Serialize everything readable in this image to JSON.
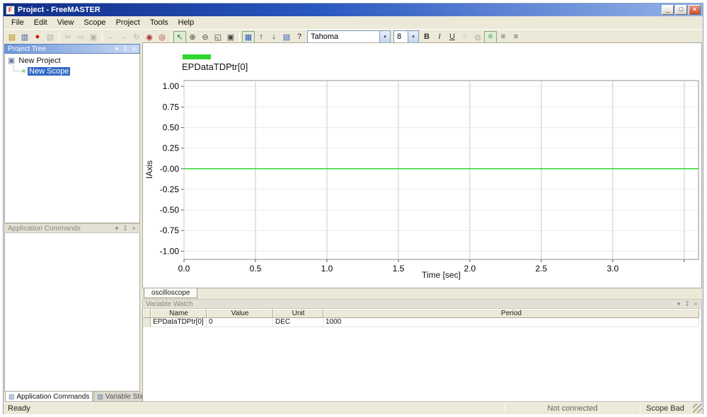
{
  "window": {
    "title": "Project - FreeMASTER",
    "app_icon_glyph": "F",
    "minimize_glyph": "_",
    "maximize_glyph": "□",
    "close_glyph": "×"
  },
  "menu": {
    "items": [
      "File",
      "Edit",
      "View",
      "Scope",
      "Project",
      "Tools",
      "Help"
    ]
  },
  "toolbar": {
    "font_combo": {
      "value": "Tahoma"
    },
    "size_combo": {
      "value": "8"
    },
    "items": [
      {
        "type": "icon",
        "name": "open-project-icon",
        "glyph": "▤",
        "color": "#b8860b",
        "state": "normal"
      },
      {
        "type": "icon",
        "name": "save-project-icon",
        "glyph": "▥",
        "color": "#33589e",
        "state": "normal"
      },
      {
        "type": "icon",
        "name": "stop-communication-icon",
        "glyph": "●",
        "color": "#cc1100",
        "state": "normal"
      },
      {
        "type": "icon",
        "name": "options-icon",
        "glyph": "▧",
        "color": "#8a8a8a",
        "state": "disabled"
      },
      {
        "type": "sep"
      },
      {
        "type": "icon",
        "name": "cut-icon",
        "glyph": "✂",
        "color": "#8a8a8a",
        "state": "disabled"
      },
      {
        "type": "icon",
        "name": "copy-icon",
        "glyph": "▭",
        "color": "#8a8a8a",
        "state": "disabled"
      },
      {
        "type": "icon",
        "name": "paste-icon",
        "glyph": "▣",
        "color": "#8a8a8a",
        "state": "disabled"
      },
      {
        "type": "sep"
      },
      {
        "type": "icon",
        "name": "back-icon",
        "glyph": "←",
        "color": "#8a8a8a",
        "state": "disabled"
      },
      {
        "type": "icon",
        "name": "forward-icon",
        "glyph": "→",
        "color": "#8a8a8a",
        "state": "disabled"
      },
      {
        "type": "icon",
        "name": "refresh-icon",
        "glyph": "↻",
        "color": "#8a8a8a",
        "state": "disabled"
      },
      {
        "type": "icon",
        "name": "record-icon",
        "glyph": "◉",
        "color": "#aa3333",
        "state": "normal"
      },
      {
        "type": "icon",
        "name": "pin-variables-icon",
        "glyph": "◎",
        "color": "#aa3333",
        "state": "normal"
      },
      {
        "type": "sep"
      },
      {
        "type": "icon",
        "name": "cursor-tool-icon",
        "glyph": "↖",
        "color": "#1d7a1d",
        "state": "pressed"
      },
      {
        "type": "icon",
        "name": "zoom-in-icon",
        "glyph": "⊕",
        "color": "#444444",
        "state": "normal"
      },
      {
        "type": "icon",
        "name": "zoom-out-icon",
        "glyph": "⊖",
        "color": "#444444",
        "state": "normal"
      },
      {
        "type": "icon",
        "name": "zoom-fit-icon",
        "glyph": "◱",
        "color": "#444444",
        "state": "normal"
      },
      {
        "type": "icon",
        "name": "copy-image-icon",
        "glyph": "▣",
        "color": "#444444",
        "state": "normal"
      },
      {
        "type": "sep"
      },
      {
        "type": "icon",
        "name": "grid-icon",
        "glyph": "▦",
        "color": "#3355bb",
        "state": "pressed"
      },
      {
        "type": "icon",
        "name": "move-up-icon",
        "glyph": "↑",
        "color": "#222222",
        "state": "normal"
      },
      {
        "type": "icon",
        "name": "move-down-icon",
        "glyph": "↓",
        "color": "#222222",
        "state": "normal"
      },
      {
        "type": "icon",
        "name": "properties-icon",
        "glyph": "▤",
        "color": "#3355bb",
        "state": "normal"
      },
      {
        "type": "icon",
        "name": "context-help-icon",
        "glyph": "?",
        "color": "#222222",
        "state": "normal"
      },
      {
        "type": "font-combo"
      },
      {
        "type": "size-combo"
      },
      {
        "type": "icon",
        "name": "bold-button",
        "glyph": "B",
        "color": "#333333",
        "state": "normal",
        "bold": true
      },
      {
        "type": "icon",
        "name": "italic-button",
        "glyph": "I",
        "color": "#333333",
        "state": "normal",
        "italic": true
      },
      {
        "type": "icon",
        "name": "underline-button",
        "glyph": "U",
        "color": "#333333",
        "state": "normal",
        "underline": true
      },
      {
        "type": "icon",
        "name": "bullet-list-icon",
        "glyph": "○",
        "color": "#8a8a8a",
        "state": "disabled"
      },
      {
        "type": "icon",
        "name": "numbered-list-icon",
        "glyph": "◍",
        "color": "#8a8a8a",
        "state": "disabled"
      },
      {
        "type": "icon",
        "name": "align-left-icon",
        "glyph": "≡",
        "color": "#2f9e2f",
        "state": "pressed"
      },
      {
        "type": "icon",
        "name": "align-center-icon",
        "glyph": "≡",
        "color": "#555555",
        "state": "normal"
      },
      {
        "type": "icon",
        "name": "align-right-icon",
        "glyph": "≡",
        "color": "#555555",
        "state": "normal"
      }
    ]
  },
  "panel_buttons": {
    "chevron": "▾",
    "pin": "↧",
    "close": "×"
  },
  "project_tree": {
    "title": "Project Tree",
    "items": [
      {
        "label": "New Project",
        "icon": "project-icon",
        "glyph": "▣",
        "icon_color": "#6b7f9e",
        "level": 0,
        "selected": false
      },
      {
        "label": "New Scope",
        "icon": "scope-icon",
        "glyph": "≈",
        "icon_color": "#18a018",
        "level": 1,
        "selected": true
      }
    ]
  },
  "application_commands": {
    "title": "Application Commands"
  },
  "dock_tabs": [
    {
      "label": "Application Commands",
      "icon_glyph": "▧",
      "active": true
    },
    {
      "label": "Variable Stimulus",
      "icon_glyph": "▧",
      "active": false
    }
  ],
  "scope": {
    "tab_label": "oscilloscope",
    "chart_data": {
      "type": "line",
      "title": "EPDataTDPtr[0]",
      "xlabel": "Time [sec]",
      "ylabel": "IAxis",
      "xlim": [
        0,
        3.6
      ],
      "ylim": [
        -1.1,
        1.07
      ],
      "x_ticks": [
        0,
        0.5,
        1,
        1.5,
        2,
        2.5,
        3,
        3.5
      ],
      "x_tick_labels": [
        "0.0",
        "0.5",
        "1.0",
        "1.5",
        "2.0",
        "2.5",
        "3.0",
        ""
      ],
      "y_ticks": [
        1,
        0.75,
        0.5,
        0.25,
        0,
        -0.25,
        -0.5,
        -0.75,
        -1
      ],
      "y_tick_labels": [
        "1.00",
        "0.75",
        "0.50",
        "0.25",
        "-0.00",
        "-0.25",
        "-0.50",
        "-0.75",
        "-1.00"
      ],
      "grid": true,
      "legend_position": "top-left",
      "series": [
        {
          "name": "EPDataTDPtr[0]",
          "color": "#2ed52e",
          "x": [
            0,
            3.6
          ],
          "y": [
            0,
            0
          ]
        }
      ]
    }
  },
  "variable_watch": {
    "title": "Variable Watch",
    "columns": [
      "Name",
      "Value",
      "Unit",
      "Period"
    ],
    "rows": [
      [
        "EPDataTDPtr[0]",
        "0",
        "DEC",
        "1000"
      ]
    ]
  },
  "status_bar": {
    "ready": "Ready",
    "connection": "Not connected",
    "scope": "Scope Bad"
  }
}
